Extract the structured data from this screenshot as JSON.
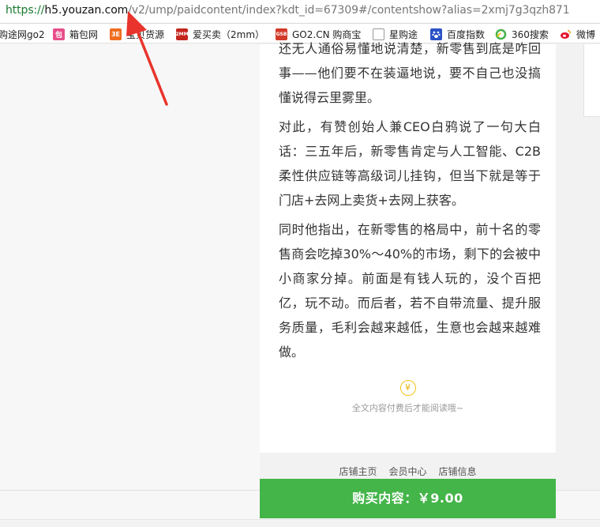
{
  "address_bar": {
    "scheme": "https://",
    "host": "h5.youzan.com",
    "path": "/v2/ump/paidcontent/index?kdt_id=67309#/contentshow?alias=2xmj7g3qzh871"
  },
  "bookmarks": [
    {
      "label": "购途网go2",
      "icon": "bookmark-icon",
      "color": "#888888"
    },
    {
      "label": "箱包网",
      "icon": "bag-icon",
      "color": "#e84f8a",
      "glyph": "包"
    },
    {
      "label": "宝贝货源",
      "icon": "source-icon",
      "color": "#ef6d1f",
      "glyph": "3E"
    },
    {
      "label": "爱买卖（2mm）",
      "icon": "2mm-icon",
      "color": "#c4261d",
      "glyph": "2MM"
    },
    {
      "label": "GO2.CN 购商宝",
      "icon": "gsb-icon",
      "color": "#d23a2a",
      "glyph": "GSB"
    },
    {
      "label": "星购途",
      "icon": "page-icon",
      "color": "#ffffff"
    },
    {
      "label": "百度指数",
      "icon": "baidu-paw-icon",
      "color": "#2b52c7"
    },
    {
      "label": "360搜索",
      "icon": "360-icon",
      "color": "#49b34c"
    },
    {
      "label": "微博",
      "icon": "weibo-icon",
      "color": "#e6162d"
    }
  ],
  "article": {
    "para1": "还无人通俗易懂地说清楚，新零售到底是咋回事——他们要不在装逼地说，要不自己也没搞懂说得云里雾里。",
    "para2": "对此，有赞创始人兼CEO白鸦说了一句大白话：三五年后，新零售肯定与人工智能、C2B柔性供应链等高级词儿挂钩，但当下就是等于门店+去网上卖货+去网上获客。",
    "para3": "同时他指出，在新零售的格局中，前十名的零售商会吃掉30%～40%的市场，剩下的会被中小商家分掉。前面是有钱人玩的，没个百把亿，玩不动。而后者，若不自带流量、提升服务质量，毛利会越来越低，生意也会越来越难做。"
  },
  "lock": {
    "icon": "yen-icon",
    "glyph": "¥",
    "text": "全文内容付费后才能阅读哦~"
  },
  "footer": {
    "home": "店铺主页",
    "member": "会员中心",
    "info": "店铺信息"
  },
  "buy_button": {
    "label": "购买内容：￥9.00",
    "color": "#44b549"
  },
  "annotation": {
    "color": "#e8342c"
  }
}
